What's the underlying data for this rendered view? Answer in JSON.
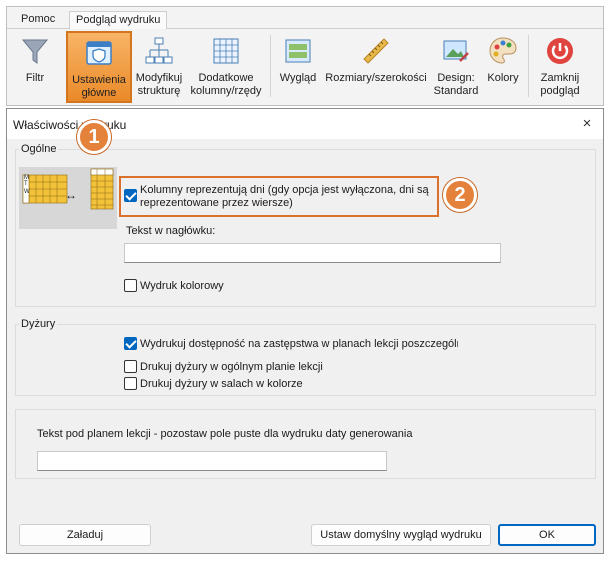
{
  "ribbon": {
    "tabs": [
      "Pomoc",
      "Podgląd wydruku"
    ],
    "buttons": [
      {
        "label": "Filtr"
      },
      {
        "label": "Ustawienia\ngłówne"
      },
      {
        "label": "Modyfikuj\nstrukturę"
      },
      {
        "label": "Dodatkowe\nkolumny/rzędy"
      },
      {
        "label": "Wygląd"
      },
      {
        "label": "Rozmiary/szerokości"
      },
      {
        "label": "Design:\nStandard"
      },
      {
        "label": "Kolory"
      },
      {
        "label": "Zamknij\npodgląd"
      }
    ]
  },
  "dialog": {
    "title": "Właściwości wydruku",
    "close_icon": "×",
    "general": {
      "label": "Ogólne",
      "columns_days_check": "Kolumny reprezentują dni (gdy opcja jest wyłączona, dni są\nreprezentowane przez wiersze)",
      "header_text_label": "Tekst w nagłówku:",
      "header_text_value": "",
      "color_print_check": "Wydruk kolorowy",
      "preview_letters": [
        "M",
        "T",
        "W"
      ],
      "preview_arrow": "↔"
    },
    "duty": {
      "label": "Dyżury",
      "items": [
        "Wydrukuj dostępność na zastępstwa w planach lekcji poszczególn",
        "Drukuj dyżury w ogólnym planie lekcji",
        "Drukuj dyżury w salach w kolorze"
      ]
    },
    "footer_text": {
      "label": "Tekst pod planem lekcji - pozostaw pole puste dla wydruku daty generowania",
      "value": ""
    },
    "buttons": {
      "load": "Załaduj",
      "default": "Ustaw domyślny wygląd wydruku",
      "ok": "OK"
    }
  },
  "callouts": [
    "1",
    "2"
  ],
  "colors": {
    "accent": "#0067c0",
    "callout": "#e4813a",
    "selected_ribbon": "#ea8a2a"
  }
}
